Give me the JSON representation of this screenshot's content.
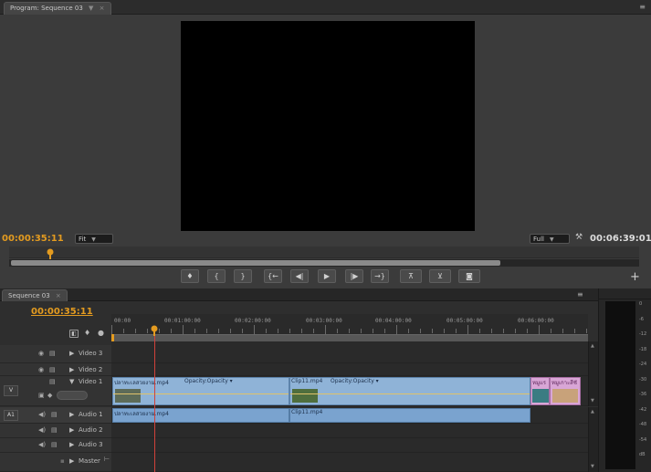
{
  "monitor": {
    "tab_title": "Program: Sequence 03",
    "tab_dropdown": "▼",
    "tab_close": "×",
    "panel_menu": "≡",
    "current_timecode": "00:00:35:11",
    "fit_select": "Fit",
    "resolution_select": "Full",
    "wrench": "🔧",
    "duration_timecode": "00:06:39:01",
    "add_button": "+",
    "transport": [
      {
        "name": "add-marker-button",
        "glyph": "♦"
      },
      {
        "name": "mark-in-button",
        "glyph": "{"
      },
      {
        "name": "mark-out-button",
        "glyph": "}"
      },
      {
        "name": "go-to-in-button",
        "glyph": "{←"
      },
      {
        "name": "step-back-button",
        "glyph": "◀|"
      },
      {
        "name": "play-button",
        "glyph": "▶"
      },
      {
        "name": "step-forward-button",
        "glyph": "|▶"
      },
      {
        "name": "go-to-out-button",
        "glyph": "→}"
      },
      {
        "name": "lift-button",
        "glyph": "⊼"
      },
      {
        "name": "extract-button",
        "glyph": "⊻"
      },
      {
        "name": "export-frame-button",
        "glyph": "◙"
      }
    ]
  },
  "sequence": {
    "tab_title": "Sequence 03",
    "tab_close": "×",
    "panel_menu": "≡",
    "timecode": "00:00:35:11",
    "ruler_labels": [
      "00:00",
      "00:01:00:00",
      "00:02:00:00",
      "00:03:00:00",
      "00:04:00:00",
      "00:05:00:00",
      "00:06:00:00"
    ],
    "video_tracks": [
      {
        "label": "Video 3",
        "toggle": "▶"
      },
      {
        "label": "Video 2",
        "toggle": "▶"
      },
      {
        "label": "Video 1",
        "toggle": "▼",
        "source": "V"
      }
    ],
    "audio_tracks": [
      {
        "label": "Audio 1",
        "toggle": "▶",
        "source": "A1"
      },
      {
        "label": "Audio 2",
        "toggle": "▶"
      },
      {
        "label": "Audio 3",
        "toggle": "▶"
      },
      {
        "label": "Master",
        "toggle": "▶"
      }
    ],
    "clips": {
      "v1_clip1": "ปลาทะเลสวยงาม.mp4",
      "v1_clip1_opacity": "Opacity:Opacity ▾",
      "v1_clip2": "Clip11.mp4",
      "v1_clip2_opacity": "Opacity:Opacity ▾",
      "v1_clip3": "หมูแร",
      "v1_clip4": "หมูเกาะสีชั",
      "a1_clip1": "ปลาทะเลสวยงาม.mp4",
      "a1_clip2": "Clip11.mp4"
    }
  },
  "meter": {
    "labels": [
      "0",
      "-6",
      "-12",
      "-18",
      "-24",
      "-30",
      "-36",
      "-42",
      "-48",
      "-54",
      "dB"
    ]
  },
  "colors": {
    "accent_timecode": "#e39b20",
    "playhead": "#d0413a",
    "video_clip": "#8fb3d7",
    "audio_clip": "#7aa3cf",
    "title_clip": "#d9a6d6"
  }
}
